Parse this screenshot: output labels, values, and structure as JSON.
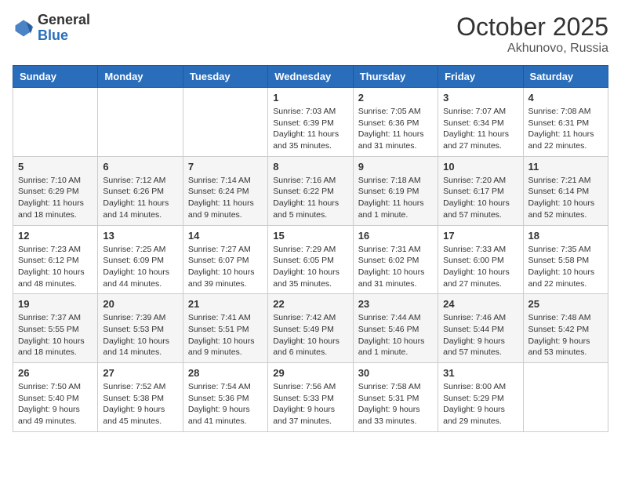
{
  "header": {
    "logo": {
      "general": "General",
      "blue": "Blue"
    },
    "title": "October 2025",
    "location": "Akhunovo, Russia"
  },
  "days_of_week": [
    "Sunday",
    "Monday",
    "Tuesday",
    "Wednesday",
    "Thursday",
    "Friday",
    "Saturday"
  ],
  "weeks": [
    [
      {
        "day": "",
        "sunrise": "",
        "sunset": "",
        "daylight": ""
      },
      {
        "day": "",
        "sunrise": "",
        "sunset": "",
        "daylight": ""
      },
      {
        "day": "",
        "sunrise": "",
        "sunset": "",
        "daylight": ""
      },
      {
        "day": "1",
        "sunrise": "Sunrise: 7:03 AM",
        "sunset": "Sunset: 6:39 PM",
        "daylight": "Daylight: 11 hours and 35 minutes."
      },
      {
        "day": "2",
        "sunrise": "Sunrise: 7:05 AM",
        "sunset": "Sunset: 6:36 PM",
        "daylight": "Daylight: 11 hours and 31 minutes."
      },
      {
        "day": "3",
        "sunrise": "Sunrise: 7:07 AM",
        "sunset": "Sunset: 6:34 PM",
        "daylight": "Daylight: 11 hours and 27 minutes."
      },
      {
        "day": "4",
        "sunrise": "Sunrise: 7:08 AM",
        "sunset": "Sunset: 6:31 PM",
        "daylight": "Daylight: 11 hours and 22 minutes."
      }
    ],
    [
      {
        "day": "5",
        "sunrise": "Sunrise: 7:10 AM",
        "sunset": "Sunset: 6:29 PM",
        "daylight": "Daylight: 11 hours and 18 minutes."
      },
      {
        "day": "6",
        "sunrise": "Sunrise: 7:12 AM",
        "sunset": "Sunset: 6:26 PM",
        "daylight": "Daylight: 11 hours and 14 minutes."
      },
      {
        "day": "7",
        "sunrise": "Sunrise: 7:14 AM",
        "sunset": "Sunset: 6:24 PM",
        "daylight": "Daylight: 11 hours and 9 minutes."
      },
      {
        "day": "8",
        "sunrise": "Sunrise: 7:16 AM",
        "sunset": "Sunset: 6:22 PM",
        "daylight": "Daylight: 11 hours and 5 minutes."
      },
      {
        "day": "9",
        "sunrise": "Sunrise: 7:18 AM",
        "sunset": "Sunset: 6:19 PM",
        "daylight": "Daylight: 11 hours and 1 minute."
      },
      {
        "day": "10",
        "sunrise": "Sunrise: 7:20 AM",
        "sunset": "Sunset: 6:17 PM",
        "daylight": "Daylight: 10 hours and 57 minutes."
      },
      {
        "day": "11",
        "sunrise": "Sunrise: 7:21 AM",
        "sunset": "Sunset: 6:14 PM",
        "daylight": "Daylight: 10 hours and 52 minutes."
      }
    ],
    [
      {
        "day": "12",
        "sunrise": "Sunrise: 7:23 AM",
        "sunset": "Sunset: 6:12 PM",
        "daylight": "Daylight: 10 hours and 48 minutes."
      },
      {
        "day": "13",
        "sunrise": "Sunrise: 7:25 AM",
        "sunset": "Sunset: 6:09 PM",
        "daylight": "Daylight: 10 hours and 44 minutes."
      },
      {
        "day": "14",
        "sunrise": "Sunrise: 7:27 AM",
        "sunset": "Sunset: 6:07 PM",
        "daylight": "Daylight: 10 hours and 39 minutes."
      },
      {
        "day": "15",
        "sunrise": "Sunrise: 7:29 AM",
        "sunset": "Sunset: 6:05 PM",
        "daylight": "Daylight: 10 hours and 35 minutes."
      },
      {
        "day": "16",
        "sunrise": "Sunrise: 7:31 AM",
        "sunset": "Sunset: 6:02 PM",
        "daylight": "Daylight: 10 hours and 31 minutes."
      },
      {
        "day": "17",
        "sunrise": "Sunrise: 7:33 AM",
        "sunset": "Sunset: 6:00 PM",
        "daylight": "Daylight: 10 hours and 27 minutes."
      },
      {
        "day": "18",
        "sunrise": "Sunrise: 7:35 AM",
        "sunset": "Sunset: 5:58 PM",
        "daylight": "Daylight: 10 hours and 22 minutes."
      }
    ],
    [
      {
        "day": "19",
        "sunrise": "Sunrise: 7:37 AM",
        "sunset": "Sunset: 5:55 PM",
        "daylight": "Daylight: 10 hours and 18 minutes."
      },
      {
        "day": "20",
        "sunrise": "Sunrise: 7:39 AM",
        "sunset": "Sunset: 5:53 PM",
        "daylight": "Daylight: 10 hours and 14 minutes."
      },
      {
        "day": "21",
        "sunrise": "Sunrise: 7:41 AM",
        "sunset": "Sunset: 5:51 PM",
        "daylight": "Daylight: 10 hours and 9 minutes."
      },
      {
        "day": "22",
        "sunrise": "Sunrise: 7:42 AM",
        "sunset": "Sunset: 5:49 PM",
        "daylight": "Daylight: 10 hours and 6 minutes."
      },
      {
        "day": "23",
        "sunrise": "Sunrise: 7:44 AM",
        "sunset": "Sunset: 5:46 PM",
        "daylight": "Daylight: 10 hours and 1 minute."
      },
      {
        "day": "24",
        "sunrise": "Sunrise: 7:46 AM",
        "sunset": "Sunset: 5:44 PM",
        "daylight": "Daylight: 9 hours and 57 minutes."
      },
      {
        "day": "25",
        "sunrise": "Sunrise: 7:48 AM",
        "sunset": "Sunset: 5:42 PM",
        "daylight": "Daylight: 9 hours and 53 minutes."
      }
    ],
    [
      {
        "day": "26",
        "sunrise": "Sunrise: 7:50 AM",
        "sunset": "Sunset: 5:40 PM",
        "daylight": "Daylight: 9 hours and 49 minutes."
      },
      {
        "day": "27",
        "sunrise": "Sunrise: 7:52 AM",
        "sunset": "Sunset: 5:38 PM",
        "daylight": "Daylight: 9 hours and 45 minutes."
      },
      {
        "day": "28",
        "sunrise": "Sunrise: 7:54 AM",
        "sunset": "Sunset: 5:36 PM",
        "daylight": "Daylight: 9 hours and 41 minutes."
      },
      {
        "day": "29",
        "sunrise": "Sunrise: 7:56 AM",
        "sunset": "Sunset: 5:33 PM",
        "daylight": "Daylight: 9 hours and 37 minutes."
      },
      {
        "day": "30",
        "sunrise": "Sunrise: 7:58 AM",
        "sunset": "Sunset: 5:31 PM",
        "daylight": "Daylight: 9 hours and 33 minutes."
      },
      {
        "day": "31",
        "sunrise": "Sunrise: 8:00 AM",
        "sunset": "Sunset: 5:29 PM",
        "daylight": "Daylight: 9 hours and 29 minutes."
      },
      {
        "day": "",
        "sunrise": "",
        "sunset": "",
        "daylight": ""
      }
    ]
  ]
}
